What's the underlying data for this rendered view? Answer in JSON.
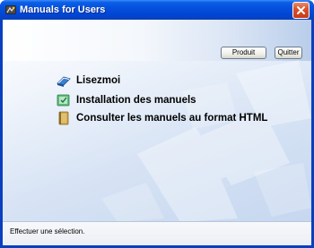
{
  "window": {
    "title": "Manuals for Users"
  },
  "toolbar": {
    "product_label": "Produit",
    "quit_label": "Quitter"
  },
  "menu": {
    "items": [
      {
        "label": "Lisezmoi",
        "icon": "readme-icon"
      },
      {
        "label": "Installation des manuels",
        "icon": "install-icon"
      },
      {
        "label": "Consulter les manuels au format HTML",
        "icon": "book-icon"
      }
    ]
  },
  "status": {
    "text": "Effectuer une sélection."
  },
  "colors": {
    "titlebar": "#0550dc",
    "close_button": "#d9522c",
    "client_background": "#d8e4f5"
  }
}
